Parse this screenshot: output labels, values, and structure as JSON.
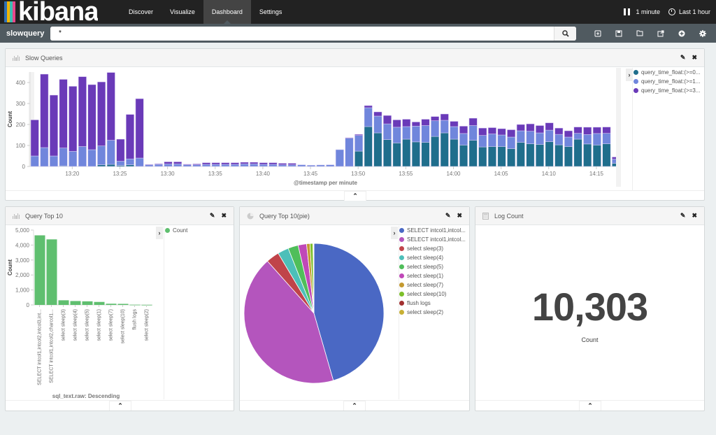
{
  "app": {
    "logo_text": "kibana",
    "logo_stripe_colors": [
      "#e8478b",
      "#3ebeb0",
      "#f1b504",
      "#2e6fb6"
    ],
    "nav_tabs": [
      {
        "label": "Discover",
        "active": false
      },
      {
        "label": "Visualize",
        "active": false
      },
      {
        "label": "Dashboard",
        "active": true
      },
      {
        "label": "Settings",
        "active": false
      }
    ],
    "refresh_interval": "1 minute",
    "time_range": "Last 1 hour"
  },
  "dashboard": {
    "name": "slowquery",
    "query_value": "*",
    "toolbar_icons": [
      "new-dashboard-icon",
      "save-icon",
      "open-icon",
      "share-icon",
      "add-visualization-icon",
      "options-icon"
    ]
  },
  "panels": {
    "slow_queries": {
      "title": "Slow Queries",
      "legend": [
        {
          "label": "query_time_float:(>=0...",
          "color": "#1f6e8c"
        },
        {
          "label": "query_time_float:(>=1...",
          "color": "#7086dc"
        },
        {
          "label": "query_time_float:(>=3...",
          "color": "#6a3ab8"
        }
      ]
    },
    "query_top10": {
      "title": "Query Top 10",
      "legend": [
        {
          "label": "Count",
          "color": "#5fbf6f"
        }
      ]
    },
    "query_top10_pie": {
      "title": "Query Top 10(pie)"
    },
    "log_count": {
      "title": "Log Count",
      "value": "10,303",
      "label": "Count"
    }
  },
  "chart_data": [
    {
      "type": "bar",
      "stacked": true,
      "title": "Slow Queries",
      "xlabel": "@timestamp per minute",
      "ylabel": "Count",
      "ylim": [
        0,
        450
      ],
      "yticks": [
        0,
        100,
        200,
        300,
        400
      ],
      "xtick_labels": [
        "13:20",
        "13:25",
        "13:30",
        "13:35",
        "13:40",
        "13:45",
        "13:50",
        "13:55",
        "14:00",
        "14:05",
        "14:10",
        "14:15"
      ],
      "x_start": "13:16",
      "x_end": "14:16",
      "series": [
        {
          "name": "query_time_float:(>=0...",
          "color": "#1f6e8c",
          "values": [
            0,
            0,
            0,
            3,
            0,
            0,
            0,
            8,
            10,
            5,
            8,
            0,
            0,
            0,
            0,
            0,
            0,
            0,
            0,
            0,
            0,
            0,
            0,
            0,
            0,
            0,
            0,
            0,
            0,
            0,
            0,
            0,
            0,
            0,
            73,
            190,
            160,
            128,
            112,
            130,
            117,
            115,
            143,
            160,
            130,
            102,
            125,
            93,
            95,
            95,
            85,
            115,
            108,
            105,
            118,
            103,
            95,
            130,
            107,
            102,
            108,
            15
          ]
        },
        {
          "name": "query_time_float:(>=1...",
          "color": "#7086dc",
          "values": [
            50,
            90,
            50,
            85,
            72,
            95,
            80,
            90,
            115,
            20,
            28,
            40,
            8,
            10,
            12,
            12,
            8,
            8,
            10,
            10,
            10,
            10,
            12,
            12,
            10,
            10,
            8,
            8,
            8,
            6,
            7,
            8,
            80,
            135,
            75,
            90,
            80,
            75,
            75,
            60,
            75,
            80,
            75,
            60,
            60,
            55,
            70,
            55,
            60,
            55,
            55,
            55,
            60,
            55,
            55,
            50,
            45,
            28,
            45,
            55,
            50,
            20
          ]
        },
        {
          "name": "query_time_float:(>=3...",
          "color": "#6a3ab8",
          "values": [
            172,
            350,
            290,
            327,
            310,
            333,
            310,
            305,
            323,
            105,
            212,
            283,
            2,
            3,
            10,
            10,
            3,
            4,
            8,
            8,
            8,
            8,
            8,
            8,
            8,
            8,
            7,
            7,
            0,
            0,
            0,
            0,
            0,
            2,
            5,
            10,
            20,
            40,
            35,
            35,
            20,
            30,
            20,
            30,
            25,
            35,
            35,
            35,
            30,
            30,
            35,
            30,
            35,
            35,
            35,
            30,
            30,
            30,
            35,
            30,
            30,
            10
          ]
        }
      ]
    },
    {
      "type": "bar",
      "title": "Query Top 10",
      "xlabel": "sql_text.raw: Descending",
      "ylabel": "Count",
      "ylim": [
        0,
        5000
      ],
      "yticks": [
        "0",
        "1,000",
        "2,000",
        "3,000",
        "4,000",
        "5,000"
      ],
      "ytick_values": [
        0,
        1000,
        2000,
        3000,
        4000,
        5000
      ],
      "categories": [
        "SELECT intcol1,intcol2,intcol3,int...",
        "SELECT intcol1,intcol2,charcol1...",
        "select sleep(3)",
        "select sleep(4)",
        "select sleep(5)",
        "select sleep(1)",
        "select sleep(7)",
        "select sleep(10)",
        "flush logs",
        "select sleep(2)"
      ],
      "values": [
        4650,
        4380,
        310,
        260,
        240,
        200,
        80,
        70,
        15,
        8
      ],
      "legend": [
        "Count"
      ],
      "color": "#5fbf6f"
    },
    {
      "type": "pie",
      "title": "Query Top 10(pie)",
      "labels": [
        "SELECT intcol1,intcol...",
        "SELECT intcol1,intcol...",
        "select sleep(3)",
        "select sleep(4)",
        "select sleep(5)",
        "select sleep(1)",
        "select sleep(7)",
        "select sleep(10)",
        "flush logs",
        "select sleep(2)"
      ],
      "values": [
        4650,
        4380,
        310,
        260,
        240,
        200,
        80,
        70,
        15,
        8
      ],
      "colors": [
        "#4a68c4",
        "#b455bd",
        "#c0444a",
        "#4dbfb9",
        "#4fbe5a",
        "#c048b8",
        "#c49a30",
        "#7dbf2a",
        "#a23030",
        "#c8b034"
      ]
    }
  ]
}
